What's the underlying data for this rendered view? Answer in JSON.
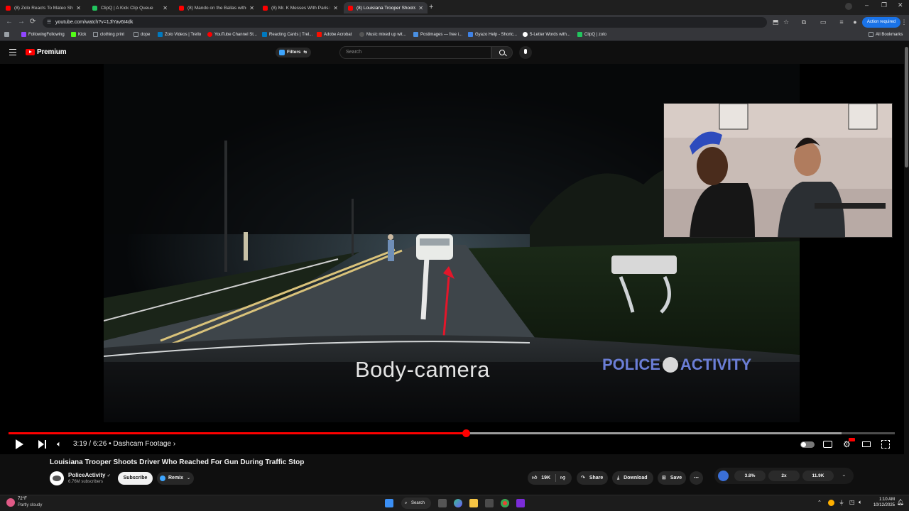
{
  "browser": {
    "tabs": [
      {
        "title": "(8) Zolo Reacts To Mateo Shoot",
        "favicon_color": "#ff0000",
        "active": false
      },
      {
        "title": "ClipQ | A Kick Clip Queue",
        "favicon_color": "#22c55e",
        "active": false
      },
      {
        "title": "(8) Mando on the Ballas withou",
        "favicon_color": "#ff0000",
        "active": false
      },
      {
        "title": "(8) Mr. K Messes With Paris in C",
        "favicon_color": "#ff0000",
        "active": false
      },
      {
        "title": "(8) Louisiana Trooper Shoots D",
        "favicon_color": "#ff0000",
        "active": true
      }
    ],
    "new_tab_label": "+",
    "url": "youtube.com/watch?v=1JlYav6I4dk",
    "action_required_label": "Action required",
    "bookmarks": [
      {
        "label": "FollowingFollowing",
        "color": "#9146ff"
      },
      {
        "label": "Kick",
        "color": "#53fc18"
      },
      {
        "label": "clothing print",
        "color": "#9aa0a6"
      },
      {
        "label": "dope",
        "color": "#9aa0a6"
      },
      {
        "label": "Zolo Videos | Trello",
        "color": "#0079bf"
      },
      {
        "label": "YouTube Channel St...",
        "color": "#ff0000"
      },
      {
        "label": "Reacting Cards | Trel...",
        "color": "#0079bf"
      },
      {
        "label": "Adobe Acrobat",
        "color": "#fa0f00"
      },
      {
        "label": "Music mixed up wit...",
        "color": "#222222"
      },
      {
        "label": "Postimages — free i...",
        "color": "#4a90e2"
      },
      {
        "label": "Gyazo Help - Shortc...",
        "color": "#3f82e5"
      },
      {
        "label": "5-Letter Words with...",
        "color": "#ffffff"
      },
      {
        "label": "ClipQ | zolo",
        "color": "#22c55e"
      }
    ],
    "all_bookmarks_label": "All Bookmarks"
  },
  "youtube": {
    "logo_text": "Premium",
    "filters_label": "Filters",
    "search_placeholder": "Search",
    "video": {
      "overlay_caption": "Body-camera",
      "watermark_left": "POLICE",
      "watermark_right": "ACTIVITY",
      "time_current": "3:19",
      "time_total": "6:26",
      "chapter": "Dashcam Footage",
      "progress_fraction": 0.516,
      "buffer_fraction": 0.94
    },
    "title": "Louisiana Trooper Shoots Driver Who Reached For Gun During Traffic Stop",
    "channel": {
      "name": "PoliceActivity",
      "subscribers": "6.76M subscribers",
      "subscribe_label": "Subscribe",
      "remix_label": "Remix"
    },
    "actions": {
      "likes": "19K",
      "share_label": "Share",
      "download_label": "Download",
      "save_label": "Save",
      "more_label": "⋯"
    },
    "stats": {
      "percent": "3.8%",
      "speed": "2x",
      "count": "11.9K"
    }
  },
  "taskbar": {
    "weather_temp": "72°F",
    "weather_desc": "Partly cloudy",
    "search_label": "Search",
    "time": "1:10 AM",
    "date": "10/12/2025"
  }
}
